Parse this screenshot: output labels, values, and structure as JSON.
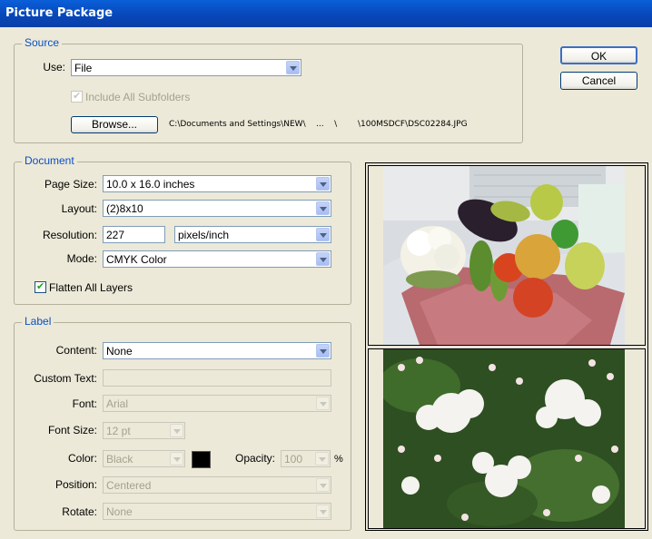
{
  "window": {
    "title": "Picture Package"
  },
  "buttons": {
    "ok": "OK",
    "cancel": "Cancel",
    "browse": "Browse..."
  },
  "source": {
    "legend": "Source",
    "use_label": "Use:",
    "use_value": "File",
    "include_subfolders_label": "Include All Subfolders",
    "include_subfolders_checked": true,
    "file_path": "C:\\Documents and Settings\\NEW\\    ...    \\        \\100MSDCF\\DSC02284.JPG"
  },
  "document": {
    "legend": "Document",
    "page_size_label": "Page Size:",
    "page_size_value": "10.0 x 16.0 inches",
    "layout_label": "Layout:",
    "layout_value": "(2)8x10",
    "resolution_label": "Resolution:",
    "resolution_value": "227",
    "resolution_unit": "pixels/inch",
    "mode_label": "Mode:",
    "mode_value": "CMYK Color",
    "flatten_label": "Flatten All Layers",
    "flatten_checked": true
  },
  "label": {
    "legend": "Label",
    "content_label": "Content:",
    "content_value": "None",
    "custom_text_label": "Custom Text:",
    "custom_text_value": "",
    "font_label": "Font:",
    "font_value": "Arial",
    "font_size_label": "Font Size:",
    "font_size_value": "12 pt",
    "color_label": "Color:",
    "color_value": "Black",
    "color_swatch": "#000000",
    "opacity_label": "Opacity:",
    "opacity_value": "100",
    "opacity_unit": "%",
    "position_label": "Position:",
    "position_value": "Centered",
    "rotate_label": "Rotate:",
    "rotate_value": "None"
  },
  "colors": {
    "title_bar": "#0a4fc4",
    "legend": "#0b4fc4",
    "dialog_bg": "#ece9d8"
  },
  "preview": {
    "images": [
      "vegetables-photo",
      "white-flowers-photo"
    ]
  }
}
